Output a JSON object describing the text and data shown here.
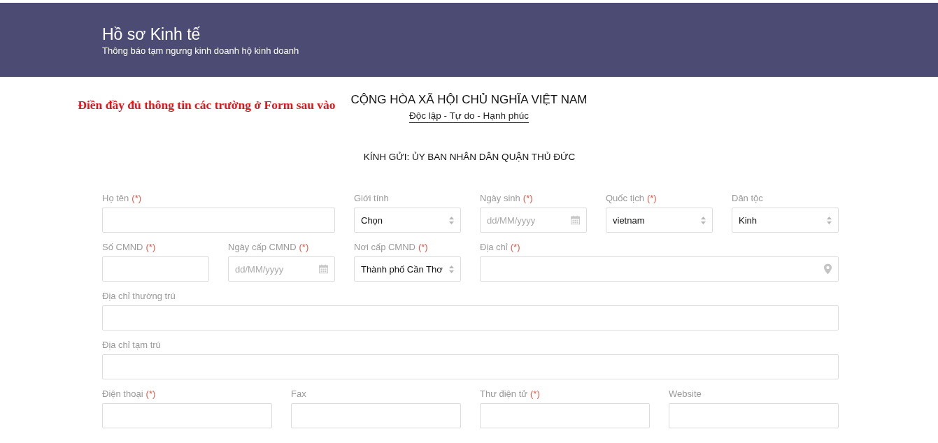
{
  "header": {
    "title": "Hồ sơ Kinh tế",
    "subtitle": "Thông báo tạm ngưng kinh doanh hộ kinh doanh"
  },
  "instruction": "Điền đầy đủ thông tin các trường ở Form sau vào",
  "heading": {
    "nation": "CỘNG HÒA XÃ HỘI CHỦ NGHĨA VIỆT NAM",
    "motto": "Độc lập - Tự do - Hạnh phúc"
  },
  "recipient": "KÍNH GỬI: ỦY BAN NHÂN DÂN QUẬN THỦ ĐỨC",
  "form_rows": [
    {
      "fields": [
        {
          "label": "Họ tên",
          "required_mark": "(*)",
          "kind": "text"
        },
        {
          "label": "Giới tính",
          "kind": "select",
          "value": "Chọn"
        },
        {
          "label": "Ngày sinh",
          "required_mark": "(*)",
          "kind": "date",
          "placeholder": "dd/MM/yyyy"
        },
        {
          "label": "Quốc tịch",
          "required_mark": "(*)",
          "kind": "select",
          "value": "vietnam"
        },
        {
          "label": "Dân tộc",
          "kind": "select",
          "value": "Kinh"
        }
      ]
    },
    {
      "fields": [
        {
          "label": "Số CMND",
          "required_mark": "(*)",
          "kind": "text"
        },
        {
          "label": "Ngày cấp CMND",
          "required_mark": "(*)",
          "kind": "date",
          "placeholder": "dd/MM/yyyy"
        },
        {
          "label": "Nơi cấp CMND",
          "required_mark": "(*)",
          "kind": "select",
          "value": "Thành phố Cần Thơ"
        },
        {
          "label": "Địa chỉ",
          "required_mark": "(*)",
          "kind": "location"
        }
      ]
    },
    {
      "fields": [
        {
          "label": "Địa chỉ thường trú",
          "kind": "text"
        }
      ]
    },
    {
      "fields": [
        {
          "label": "Địa chỉ tạm trú",
          "kind": "text"
        }
      ]
    },
    {
      "fields": [
        {
          "label": "Điện thoại",
          "required_mark": "(*)",
          "kind": "text"
        },
        {
          "label": "Fax",
          "kind": "text"
        },
        {
          "label": "Thư điện tử",
          "required_mark": "(*)",
          "kind": "text"
        },
        {
          "label": "Website",
          "kind": "text"
        }
      ]
    }
  ]
}
